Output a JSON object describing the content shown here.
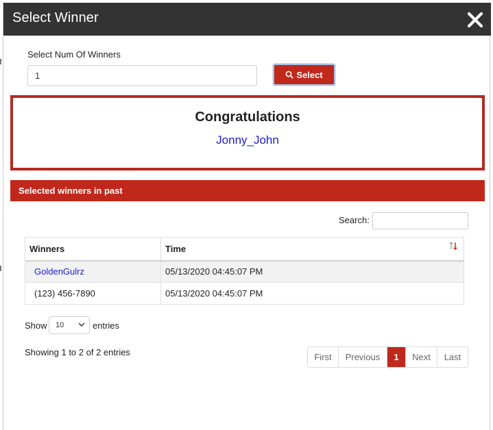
{
  "modal": {
    "title": "Select Winner"
  },
  "form": {
    "label": "Select Num Of Winners",
    "num_value": "1",
    "select_label": "Select"
  },
  "congrats": {
    "title": "Congratulations",
    "winner": "Jonny_John"
  },
  "past": {
    "header": "Selected winners in past",
    "search_label": "Search:",
    "search_value": "",
    "columns": [
      "Winners",
      "Time"
    ],
    "rows": [
      {
        "winner": "GoldenGulrz",
        "time": "05/13/2020 04:45:07 PM"
      },
      {
        "winner": "(123) 456-7890",
        "time": "05/13/2020 04:45:07 PM"
      }
    ],
    "show_label": "Show",
    "entries_value": "10",
    "entries_label": "entries",
    "info": "Showing 1 to 2 of 2 entries",
    "pagination": {
      "first": "First",
      "previous": "Previous",
      "current": "1",
      "next": "Next",
      "last": "Last"
    }
  },
  "colors": {
    "accent": "#c0281c",
    "header_bg": "#333333",
    "link": "#1a1ad6"
  },
  "icons": {
    "close": "close-icon",
    "search": "search-icon",
    "sort": "sort-icon",
    "dropdown": "chevron-down-icon"
  }
}
